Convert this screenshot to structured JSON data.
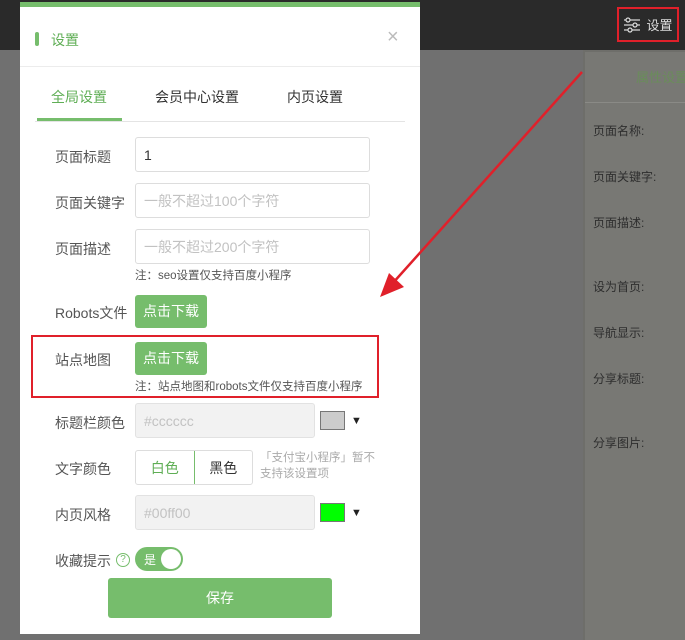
{
  "topbar": {
    "settings_label": "设置"
  },
  "right_panel": {
    "title": "属性设置",
    "labels": [
      "页面名称:",
      "页面关键字:",
      "页面描述:",
      "设为首页:",
      "导航显示:",
      "分享标题:",
      "分享图片:"
    ]
  },
  "modal": {
    "title": "设置",
    "close": "×",
    "tabs": [
      "全局设置",
      "会员中心设置",
      "内页设置"
    ],
    "page_title": {
      "label": "页面标题",
      "value": "1"
    },
    "page_keywords": {
      "label": "页面关键字",
      "placeholder": "一般不超过100个字符"
    },
    "page_description": {
      "label": "页面描述",
      "placeholder": "一般不超过200个字符",
      "note": "注：seo设置仅支持百度小程序"
    },
    "robots": {
      "label": "Robots文件",
      "button": "点击下载"
    },
    "sitemap": {
      "label": "站点地图",
      "button": "点击下载",
      "note": "注：站点地图和robots文件仅支持百度小程序"
    },
    "title_bar_color": {
      "label": "标题栏颜色",
      "value": "#cccccc",
      "swatch": "#cccccc"
    },
    "text_color": {
      "label": "文字颜色",
      "options": [
        "白色",
        "黑色"
      ],
      "selected": "白色",
      "note": "「支付宝小程序」暂不支持该设置项"
    },
    "inner_style": {
      "label": "内页风格",
      "value": "#00ff00",
      "swatch": "#00ff00"
    },
    "favorite_tip": {
      "label": "收藏提示",
      "toggle_label": "是",
      "enabled": true
    },
    "save_label": "保存"
  },
  "colors": {
    "accent": "#76bd6c",
    "annotation": "#e0202a"
  }
}
